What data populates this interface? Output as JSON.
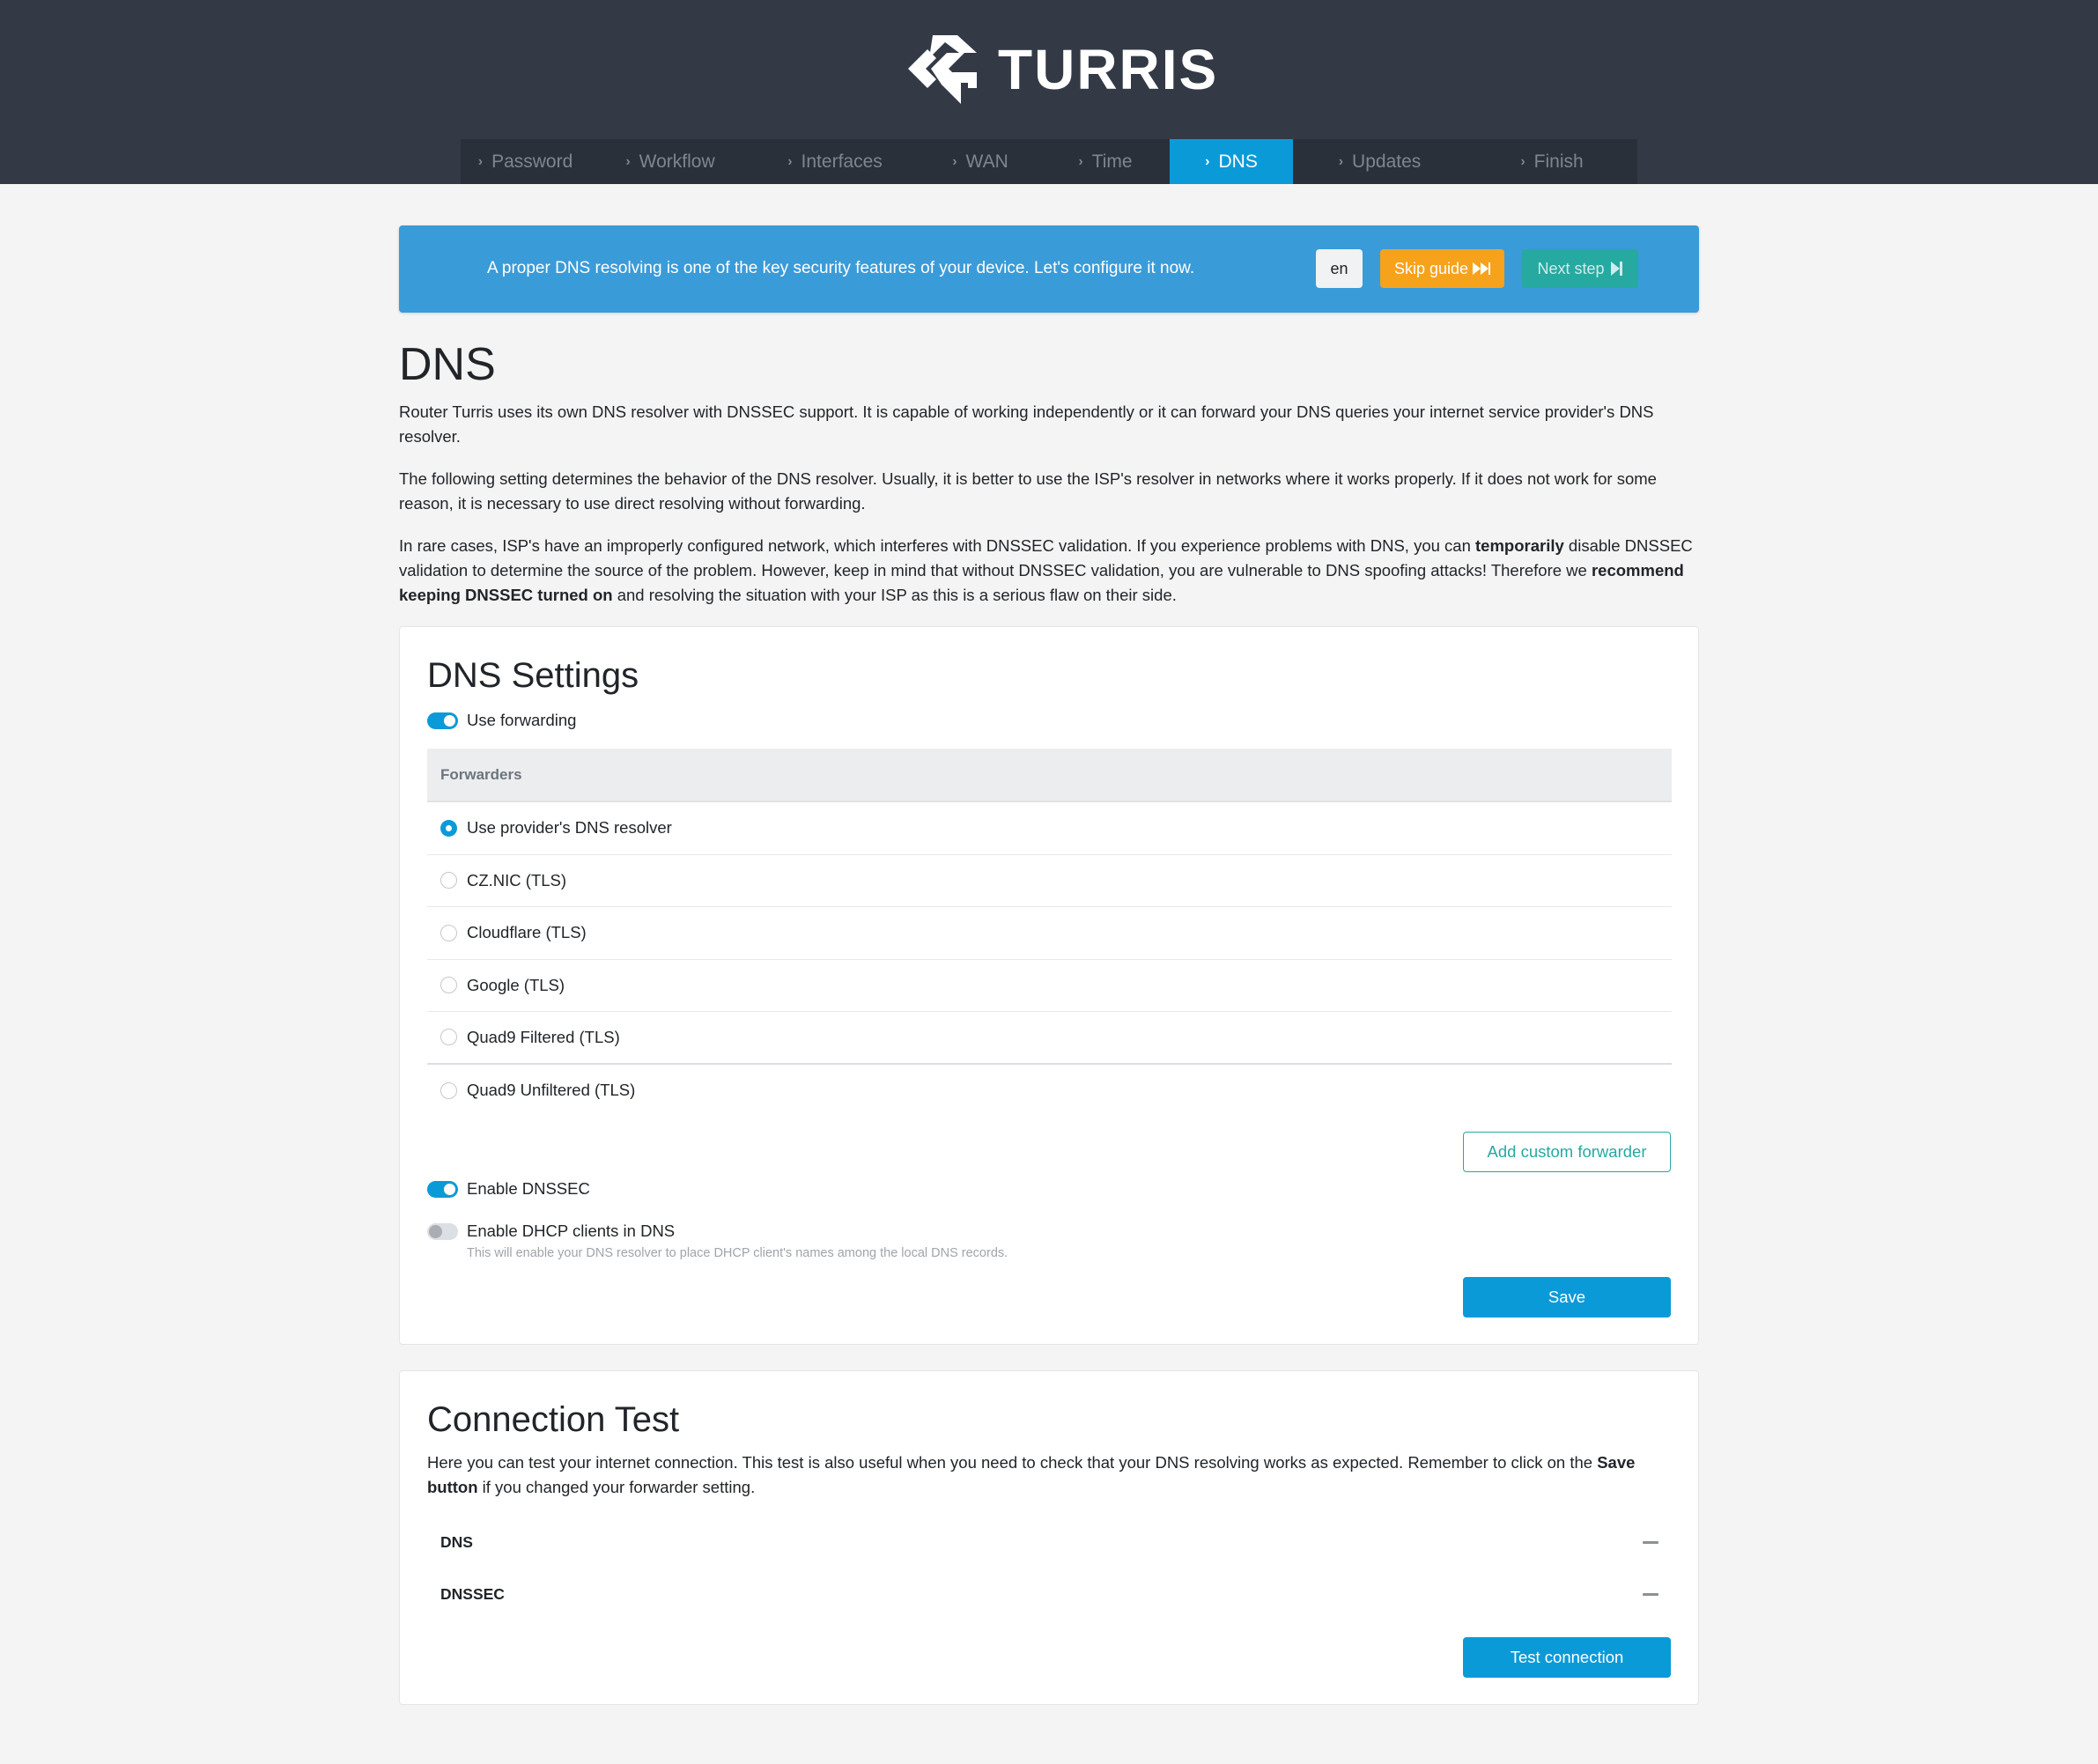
{
  "header": {
    "brand": "TURRIS",
    "steps": [
      {
        "label": "Password",
        "active": false
      },
      {
        "label": "Workflow",
        "active": false
      },
      {
        "label": "Interfaces",
        "active": false
      },
      {
        "label": "WAN",
        "active": false
      },
      {
        "label": "Time",
        "active": false
      },
      {
        "label": "DNS",
        "active": true
      },
      {
        "label": "Updates",
        "active": false
      },
      {
        "label": "Finish",
        "active": false
      }
    ],
    "step_icon": "chevron-right-icon"
  },
  "banner": {
    "text": "A proper DNS resolving is one of the key security features of your device. Let's configure it now.",
    "lang_label": "en",
    "skip_label": "Skip guide",
    "skip_icon": "fast-forward-icon",
    "next_label": "Next step",
    "next_icon": "step-forward-icon"
  },
  "page": {
    "title": "DNS",
    "para1": "Router Turris uses its own DNS resolver with DNSSEC support. It is capable of working independently or it can forward your DNS queries your internet service provider's DNS resolver.",
    "para2": "The following setting determines the behavior of the DNS resolver. Usually, it is better to use the ISP's resolver in networks where it works properly. If it does not work for some reason, it is necessary to use direct resolving without forwarding.",
    "para3": {
      "a": "In rare cases, ISP's have an improperly configured network, which interferes with DNSSEC validation. If you experience problems with DNS, you can ",
      "b": "temporarily",
      "c": " disable DNSSEC validation to determine the source of the problem. However, keep in mind that without DNSSEC validation, you are vulnerable to DNS spoofing attacks! Therefore we ",
      "d": "recommend keeping DNSSEC turned on",
      "e": " and resolving the situation with your ISP as this is a serious flaw on their side."
    }
  },
  "dns_settings": {
    "title": "DNS Settings",
    "use_forwarding_label": "Use forwarding",
    "use_forwarding": true,
    "forwarders_header": "Forwarders",
    "forwarders": [
      {
        "label": "Use provider's DNS resolver",
        "checked": true
      },
      {
        "label": "CZ.NIC (TLS)",
        "checked": false
      },
      {
        "label": "Cloudflare (TLS)",
        "checked": false
      },
      {
        "label": "Google (TLS)",
        "checked": false
      },
      {
        "label": "Quad9 Filtered (TLS)",
        "checked": false
      },
      {
        "label": "Quad9 Unfiltered (TLS)",
        "checked": false
      }
    ],
    "add_forwarder_label": "Add custom forwarder",
    "enable_dnssec_label": "Enable DNSSEC",
    "enable_dnssec": true,
    "dhcp_label": "Enable DHCP clients in DNS",
    "dhcp_enabled": false,
    "dhcp_hint": "This will enable your DNS resolver to place DHCP client's names among the local DNS records.",
    "save_label": "Save"
  },
  "connection_test": {
    "title": "Connection Test",
    "desc_a": "Here you can test your internet connection. This test is also useful when you need to check that your DNS resolving works as expected. Remember to click on the ",
    "desc_b": "Save button",
    "desc_c": " if you changed your forwarder setting.",
    "rows": [
      {
        "label": "DNS",
        "status_icon": "dash-icon"
      },
      {
        "label": "DNSSEC",
        "status_icon": "dash-icon"
      }
    ],
    "test_label": "Test connection"
  },
  "colors": {
    "header_bg": "#333a46",
    "accent": "#0b9ad8",
    "banner": "#3a9bd9",
    "skip": "#f7a21b",
    "next": "#26a9a1"
  }
}
